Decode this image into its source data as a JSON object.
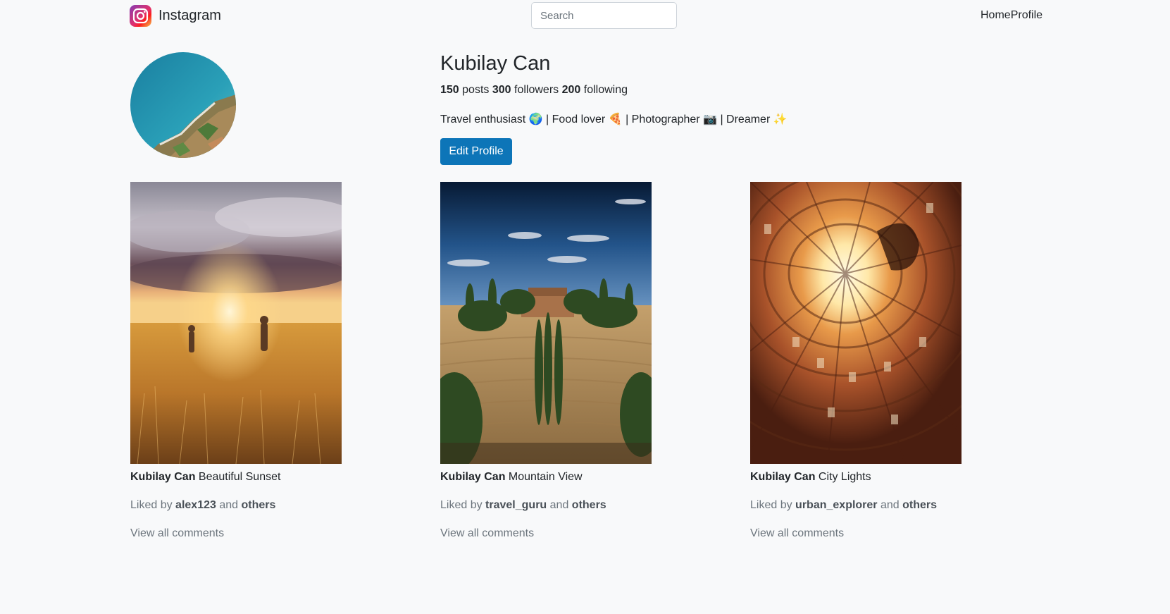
{
  "app": {
    "brand": "Instagram",
    "brand_icon": "instagram-logo-icon",
    "search_placeholder": "Search",
    "nav": {
      "home": "Home",
      "profile": "Profile"
    }
  },
  "profile": {
    "name": "Kubilay Can",
    "posts_count": "150",
    "posts_label": "posts",
    "followers_count": "300",
    "followers_label": "followers",
    "following_count": "200",
    "following_label": "following",
    "bio": "Travel enthusiast 🌍 | Food lover 🍕 | Photographer 📷 | Dreamer ✨",
    "edit_button": "Edit Profile"
  },
  "posts": [
    {
      "author": "Kubilay Can",
      "caption": "Beautiful Sunset",
      "liked_prefix": "Liked by",
      "liked_user": "alex123",
      "liked_and": "and",
      "liked_others": "others",
      "comments_link": "View all comments"
    },
    {
      "author": "Kubilay Can",
      "caption": "Mountain View",
      "liked_prefix": "Liked by",
      "liked_user": "travel_guru",
      "liked_and": "and",
      "liked_others": "others",
      "comments_link": "View all comments"
    },
    {
      "author": "Kubilay Can",
      "caption": "City Lights",
      "liked_prefix": "Liked by",
      "liked_user": "urban_explorer",
      "liked_and": "and",
      "liked_others": "others",
      "comments_link": "View all comments"
    }
  ],
  "colors": {
    "background": "#f8f9fa",
    "primary_button": "#0d75b8",
    "muted_text": "#6c757d"
  }
}
